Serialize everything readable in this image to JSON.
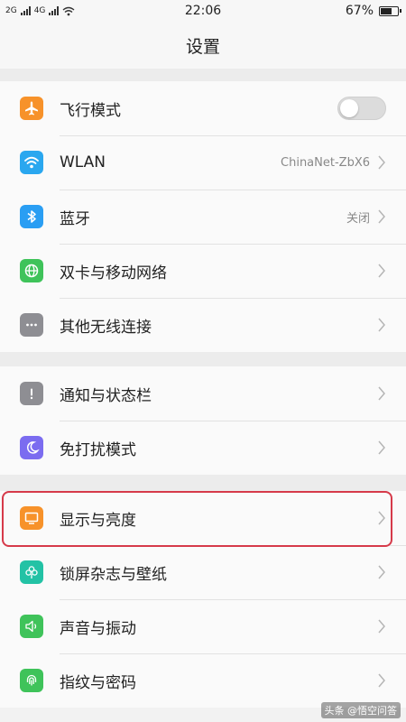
{
  "status": {
    "sim1": "2G",
    "sim2": "4G",
    "time": "22:06",
    "battery": "67%",
    "battery_level": 0.67
  },
  "page_title": "设置",
  "group1": {
    "airplane": {
      "label": "飞行模式",
      "toggle_on": false
    },
    "wlan": {
      "label": "WLAN",
      "value": "ChinaNet-ZbX6"
    },
    "bluetooth": {
      "label": "蓝牙",
      "value": "关闭"
    },
    "dual_sim": {
      "label": "双卡与移动网络"
    },
    "other_wireless": {
      "label": "其他无线连接"
    }
  },
  "group2": {
    "notifications": {
      "label": "通知与状态栏"
    },
    "dnd": {
      "label": "免打扰模式"
    }
  },
  "group3": {
    "display": {
      "label": "显示与亮度"
    },
    "lockscreen": {
      "label": "锁屏杂志与壁纸"
    },
    "sound": {
      "label": "声音与振动"
    },
    "fingerprint": {
      "label": "指纹与密码"
    }
  },
  "icon_colors": {
    "airplane": "#f7922a",
    "wlan": "#2aa7ef",
    "bluetooth": "#2a9ef3",
    "dual_sim": "#3fc35a",
    "other_wireless": "#8e8e93",
    "notifications": "#8e8e93",
    "dnd": "#7b6cf0",
    "display": "#f7922a",
    "lockscreen": "#23c2a5",
    "sound": "#3fc35a",
    "fingerprint": "#3fc35a"
  },
  "highlight_color": "#d63a4a",
  "watermark": "头条 @悟空问答"
}
